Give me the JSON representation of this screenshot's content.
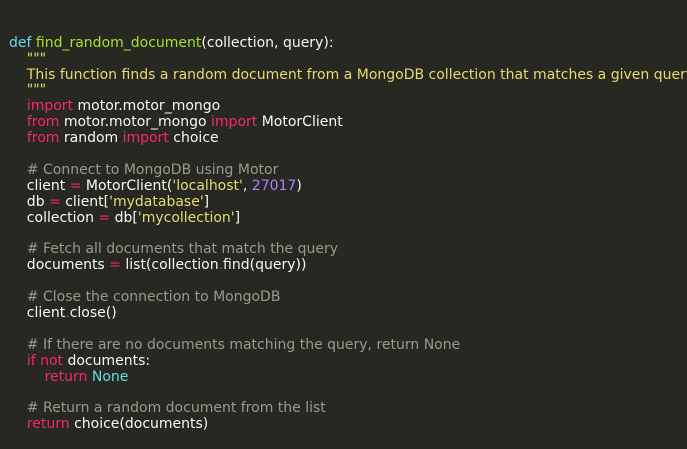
{
  "theme": {
    "background": "#272822",
    "foreground": "#f8f8f2",
    "keyword": "#f92672",
    "function": "#a6e22e",
    "definition": "#66d9ef",
    "string": "#e6db74",
    "number": "#ae81ff",
    "comment": "#9a9a8c"
  },
  "code": {
    "lines": [
      [
        {
          "t": "def",
          "c": "def"
        },
        {
          "t": " ",
          "c": "plain"
        },
        {
          "t": "find_random_document",
          "c": "fn"
        },
        {
          "t": "(collection, query):",
          "c": "plain"
        }
      ],
      [
        {
          "t": "    \"\"\"",
          "c": "doc"
        }
      ],
      [
        {
          "t": "    This function finds a random document from a MongoDB collection that matches a given query.",
          "c": "doc"
        }
      ],
      [
        {
          "t": "    \"\"\"",
          "c": "doc"
        }
      ],
      [
        {
          "t": "    ",
          "c": "plain"
        },
        {
          "t": "import",
          "c": "kw"
        },
        {
          "t": " motor.motor_mongo",
          "c": "plain"
        }
      ],
      [
        {
          "t": "    ",
          "c": "plain"
        },
        {
          "t": "from",
          "c": "kw"
        },
        {
          "t": " motor.motor_mongo ",
          "c": "plain"
        },
        {
          "t": "import",
          "c": "kw"
        },
        {
          "t": " MotorClient",
          "c": "plain"
        }
      ],
      [
        {
          "t": "    ",
          "c": "plain"
        },
        {
          "t": "from",
          "c": "kw"
        },
        {
          "t": " random ",
          "c": "plain"
        },
        {
          "t": "import",
          "c": "kw"
        },
        {
          "t": " choice",
          "c": "plain"
        }
      ],
      [
        {
          "t": "",
          "c": "plain"
        }
      ],
      [
        {
          "t": "    # Connect to MongoDB using Motor",
          "c": "cm"
        }
      ],
      [
        {
          "t": "    client ",
          "c": "plain"
        },
        {
          "t": "=",
          "c": "op"
        },
        {
          "t": " MotorClient(",
          "c": "plain"
        },
        {
          "t": "'localhost'",
          "c": "str"
        },
        {
          "t": ", ",
          "c": "plain"
        },
        {
          "t": "27017",
          "c": "num"
        },
        {
          "t": ")",
          "c": "plain"
        }
      ],
      [
        {
          "t": "    db ",
          "c": "plain"
        },
        {
          "t": "=",
          "c": "op"
        },
        {
          "t": " client[",
          "c": "plain"
        },
        {
          "t": "'mydatabase'",
          "c": "str"
        },
        {
          "t": "]",
          "c": "plain"
        }
      ],
      [
        {
          "t": "    collection ",
          "c": "plain"
        },
        {
          "t": "=",
          "c": "op"
        },
        {
          "t": " db[",
          "c": "plain"
        },
        {
          "t": "'mycollection'",
          "c": "str"
        },
        {
          "t": "]",
          "c": "plain"
        }
      ],
      [
        {
          "t": "",
          "c": "plain"
        }
      ],
      [
        {
          "t": "    # Fetch all documents that match the query",
          "c": "cm"
        }
      ],
      [
        {
          "t": "    documents ",
          "c": "plain"
        },
        {
          "t": "=",
          "c": "op"
        },
        {
          "t": " list(collection",
          "c": "plain"
        },
        {
          "t": ".",
          "c": "op"
        },
        {
          "t": "find(query))",
          "c": "plain"
        }
      ],
      [
        {
          "t": "",
          "c": "plain"
        }
      ],
      [
        {
          "t": "    # Close the connection to MongoDB",
          "c": "cm"
        }
      ],
      [
        {
          "t": "    client",
          "c": "plain"
        },
        {
          "t": ".",
          "c": "op"
        },
        {
          "t": "close()",
          "c": "plain"
        }
      ],
      [
        {
          "t": "",
          "c": "plain"
        }
      ],
      [
        {
          "t": "    # If there are no documents matching the query, return None",
          "c": "cm"
        }
      ],
      [
        {
          "t": "    ",
          "c": "plain"
        },
        {
          "t": "if",
          "c": "kw"
        },
        {
          "t": " ",
          "c": "plain"
        },
        {
          "t": "not",
          "c": "kw"
        },
        {
          "t": " documents:",
          "c": "plain"
        }
      ],
      [
        {
          "t": "        ",
          "c": "plain"
        },
        {
          "t": "return",
          "c": "kw"
        },
        {
          "t": " ",
          "c": "plain"
        },
        {
          "t": "None",
          "c": "const"
        }
      ],
      [
        {
          "t": "",
          "c": "plain"
        }
      ],
      [
        {
          "t": "    # Return a random document from the list",
          "c": "cm"
        }
      ],
      [
        {
          "t": "    ",
          "c": "plain"
        },
        {
          "t": "return",
          "c": "kw"
        },
        {
          "t": " choice(documents)",
          "c": "plain"
        }
      ]
    ]
  }
}
